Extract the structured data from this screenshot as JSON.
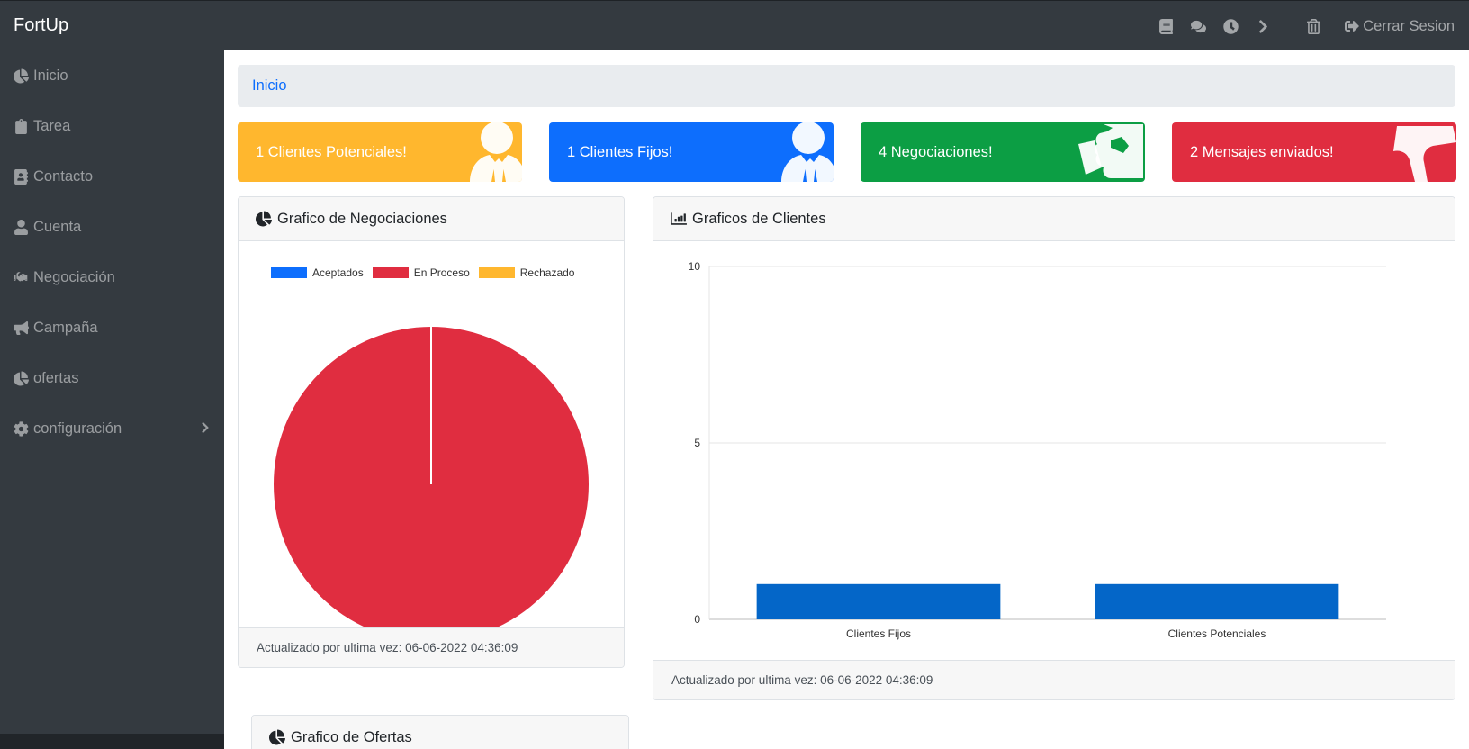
{
  "app": {
    "brand": "FortUp"
  },
  "navbar": {
    "icons": [
      "book-icon",
      "comments-icon",
      "clock-icon",
      "chevron-right-icon",
      "trash-icon"
    ],
    "logout_label": "Cerrar Sesion"
  },
  "sidebar": {
    "items": [
      {
        "label": "Inicio",
        "icon": "pie-chart-icon"
      },
      {
        "label": "Tarea",
        "icon": "clipboard-icon"
      },
      {
        "label": "Contacto",
        "icon": "address-book-icon"
      },
      {
        "label": "Cuenta",
        "icon": "user-icon"
      },
      {
        "label": "Negociación",
        "icon": "handshake-icon"
      },
      {
        "label": "Campaña",
        "icon": "bullhorn-icon"
      },
      {
        "label": "ofertas",
        "icon": "pie-chart-icon"
      },
      {
        "label": "configuración",
        "icon": "gear-icon"
      }
    ]
  },
  "breadcrumb": {
    "current": "Inicio"
  },
  "stats": [
    {
      "label": "1 Clientes Potenciales!",
      "color": "#ffb72e",
      "icon": "user-tie-icon"
    },
    {
      "label": "1 Clientes Fijos!",
      "color": "#0d6efd",
      "icon": "user-tie-icon"
    },
    {
      "label": "4 Negociaciones!",
      "color": "#0c9e44",
      "icon": "handshake-icon"
    },
    {
      "label": "2 Mensajes enviados!",
      "color": "#e02d40",
      "icon": "bullhorn-icon"
    }
  ],
  "pie_panel": {
    "title": "Grafico de Negociaciones",
    "footer": "Actualizado por ultima vez: 06-06-2022 04:36:09"
  },
  "bar_panel": {
    "title": "Graficos de Clientes",
    "footer": "Actualizado por ultima vez: 06-06-2022 04:36:09"
  },
  "offers_panel": {
    "title": "Grafico de Ofertas"
  },
  "chart_data": [
    {
      "type": "pie",
      "title": "Grafico de Negociaciones",
      "labels": [
        "Aceptados",
        "En Proceso",
        "Rechazado"
      ],
      "values": [
        0,
        1,
        0
      ],
      "colors": [
        "#0d6efd",
        "#e02d40",
        "#ffb72e"
      ],
      "legend": "top"
    },
    {
      "type": "bar",
      "title": "Graficos de Clientes",
      "categories": [
        "Clientes Fijos",
        "Clientes Potenciales"
      ],
      "values": [
        1,
        1
      ],
      "color": "#0466c8",
      "ylim": [
        0,
        10
      ],
      "yticks": [
        0,
        5,
        10
      ],
      "grid": true
    }
  ]
}
